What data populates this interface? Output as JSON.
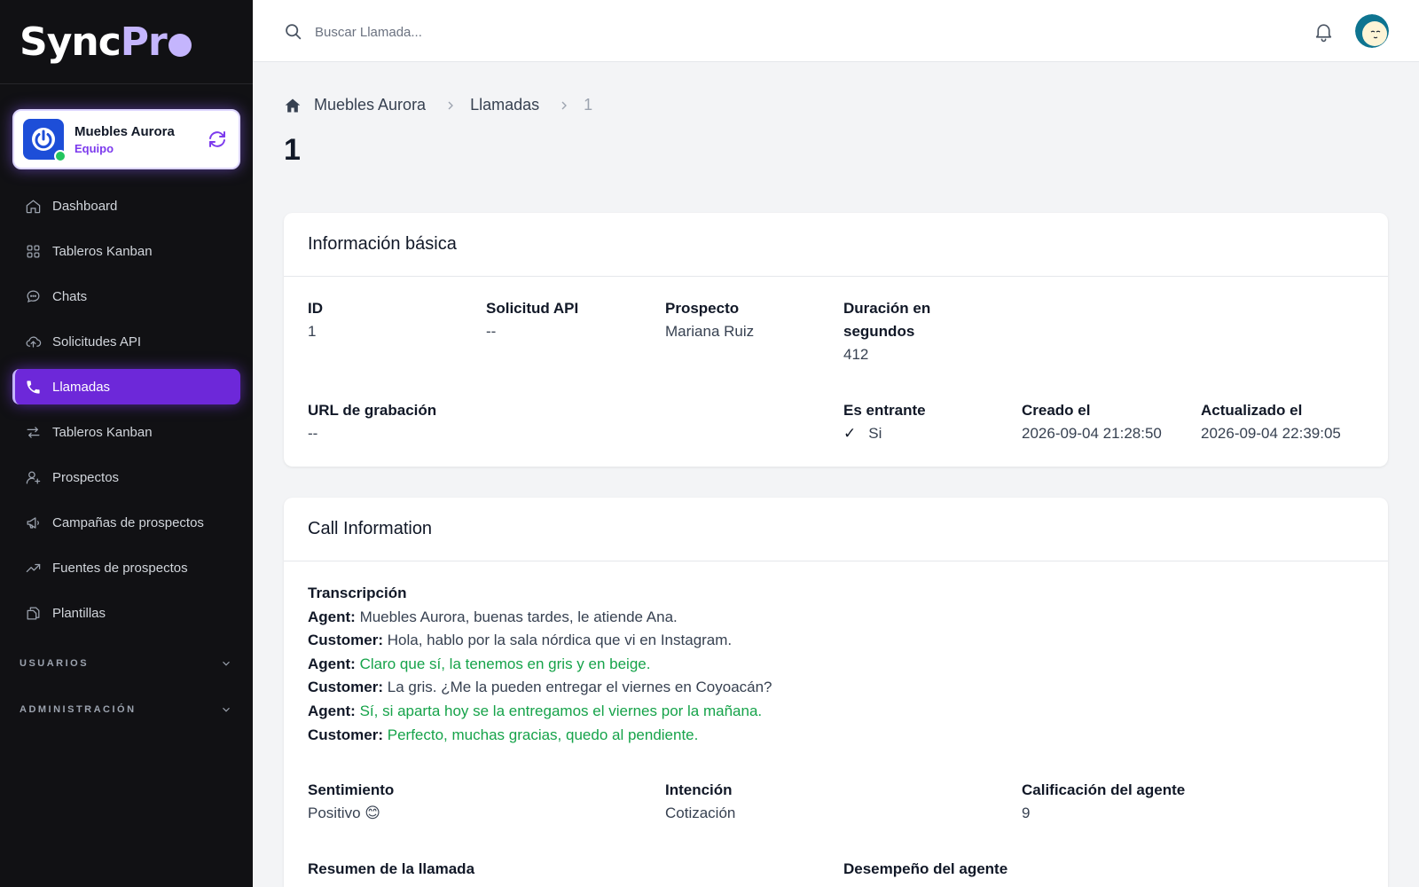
{
  "brand": {
    "name_a": "Sync",
    "name_b": "Pr"
  },
  "team": {
    "name": "Muebles Aurora",
    "role": "Equipo"
  },
  "nav": [
    {
      "label": "Dashboard",
      "icon": "home-icon"
    },
    {
      "label": "Tableros Kanban",
      "icon": "grid-icon"
    },
    {
      "label": "Chats",
      "icon": "chat-icon"
    },
    {
      "label": "Solicitudes API",
      "icon": "cloud-upload-icon"
    },
    {
      "label": "Llamadas",
      "icon": "phone-icon",
      "active": true
    },
    {
      "label": "Tableros Kanban",
      "icon": "arrows-exchange-icon"
    },
    {
      "label": "Prospectos",
      "icon": "user-plus-icon"
    },
    {
      "label": "Campañas de prospectos",
      "icon": "megaphone-icon"
    },
    {
      "label": "Fuentes de prospectos",
      "icon": "trend-up-icon"
    },
    {
      "label": "Plantillas",
      "icon": "document-copy-icon"
    }
  ],
  "sections": {
    "users": "USUARIOS",
    "admin": "ADMINISTRACIÓN"
  },
  "search": {
    "placeholder": "Buscar Llamada..."
  },
  "breadcrumb": {
    "home": "Muebles Aurora",
    "section": "Llamadas",
    "current": "1"
  },
  "page": {
    "title": "1"
  },
  "basic": {
    "title": "Información básica",
    "id_label": "ID",
    "id_value": "1",
    "api_label": "Solicitud API",
    "api_value": "--",
    "prospect_label": "Prospecto",
    "prospect_value": "Mariana Ruiz",
    "duration_label_1": "Duración en",
    "duration_label_2": "segundos",
    "duration_value": "412",
    "recording_label": "URL de grabación",
    "recording_value": "--",
    "incoming_label": "Es entrante",
    "incoming_check": "✓",
    "incoming_value": "Si",
    "created_label": "Creado el",
    "created_value": "2026-09-04 21:28:50",
    "updated_label": "Actualizado el",
    "updated_value": "2026-09-04 22:39:05"
  },
  "call": {
    "title": "Call Information",
    "transcript_label": "Transcripción",
    "transcript": [
      {
        "speaker": "Agent:",
        "text": "Muebles Aurora, buenas tardes, le atiende Ana."
      },
      {
        "speaker": "Customer:",
        "text": "Hola, hablo por la sala nórdica que vi en Instagram."
      },
      {
        "speaker": "Agent:",
        "text": "Claro que sí, la tenemos en gris y en beige."
      },
      {
        "speaker": "Customer:",
        "text": "La gris. ¿Me la pueden entregar el viernes en Coyoacán?"
      },
      {
        "speaker": "Agent:",
        "text": "Sí, si aparta hoy se la entregamos el viernes por la mañana."
      },
      {
        "speaker": "Customer:",
        "text": "Perfecto, muchas gracias, quedo al pendiente."
      }
    ],
    "sentiment_label": "Sentimiento",
    "sentiment_value": "Positivo 😊",
    "intent_label": "Intención",
    "intent_value": "Cotización",
    "rating_label": "Calificación del agente",
    "rating_value": "9",
    "summary_label": "Resumen de la llamada",
    "performance_label": "Desempeño del agente"
  },
  "colors": {
    "accent": "#6d28d9",
    "positive": "#16a34a",
    "sidebar": "#111114"
  }
}
